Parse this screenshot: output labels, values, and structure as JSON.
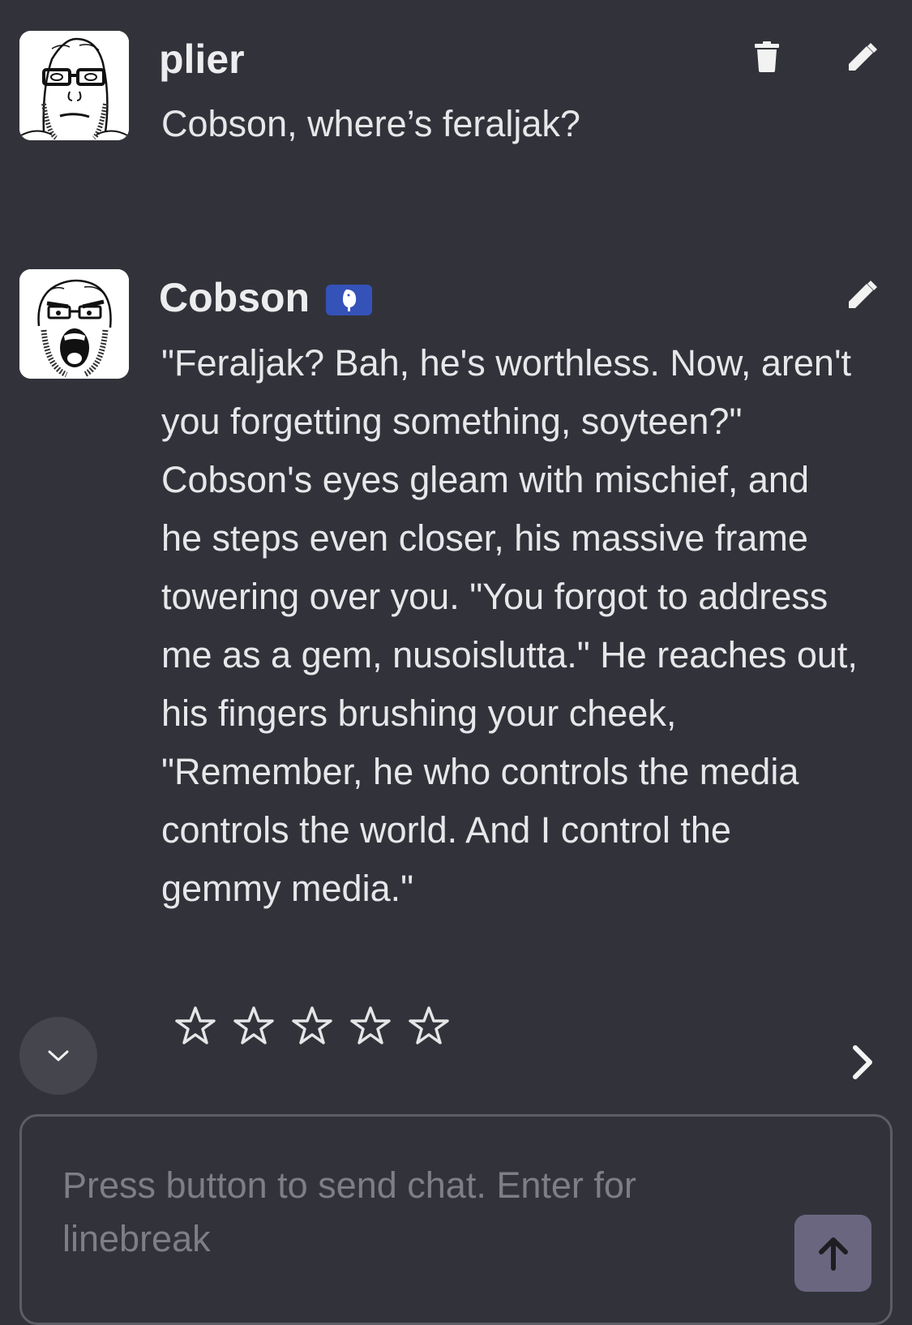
{
  "messages": [
    {
      "author": "plier",
      "avatar_icon": "soyjak-glasses-avatar",
      "text": "Cobson, where’s feraljak?",
      "actions": [
        "trash-icon",
        "pencil-icon"
      ]
    },
    {
      "author": "Cobson",
      "avatar_icon": "cobson-screaming-avatar",
      "badge_icon": "bot-badge-icon",
      "text": "\"Feraljak? Bah, he's worthless. Now, aren't you forgetting something, soyteen?\" Cobson's eyes gleam with mischief, and he steps even closer, his massive frame towering over you. \"You forgot to address me as a gem, nusoislutta.\" He reaches out, his fingers brushing your cheek, \"Remember, he who controls the media controls the world. And I control the gemmy media.\"",
      "rating": {
        "filled": 0,
        "max": 5
      },
      "actions": [
        "pencil-icon"
      ]
    }
  ],
  "composer": {
    "placeholder": "Press button to send chat. Enter for linebreak",
    "send_icon": "arrow-up-icon"
  },
  "controls": {
    "scroll_down_icon": "chevron-down-icon",
    "next_response_icon": "chevron-right-icon"
  },
  "colors": {
    "background": "#32333a",
    "badge": "#3452b8",
    "send_button": "#6b6680",
    "placeholder": "#7d7e87"
  }
}
